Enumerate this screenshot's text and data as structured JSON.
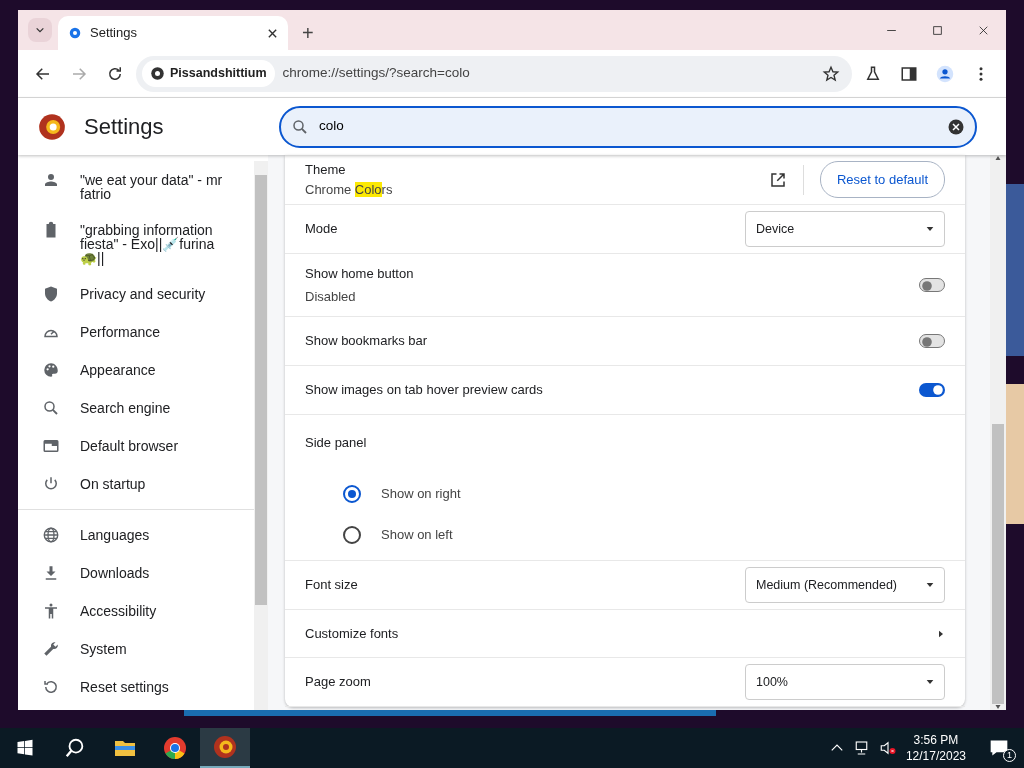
{
  "window": {
    "tab_title": "Settings",
    "new_tab": "+"
  },
  "toolbar": {
    "site_name": "Pissandshittium",
    "url": "chrome://settings/?search=colo"
  },
  "header": {
    "title": "Settings",
    "search_value": "colo"
  },
  "sidebar": {
    "groups": [
      [
        {
          "label": "\"we eat your data\" - mr fatrio"
        },
        {
          "label": "\"grabbing information fiesta\" - Exo||💉furina 🐢||"
        },
        {
          "label": "Privacy and security"
        },
        {
          "label": "Performance"
        },
        {
          "label": "Appearance"
        },
        {
          "label": "Search engine"
        },
        {
          "label": "Default browser"
        },
        {
          "label": "On startup"
        }
      ],
      [
        {
          "label": "Languages"
        },
        {
          "label": "Downloads"
        },
        {
          "label": "Accessibility"
        },
        {
          "label": "System"
        },
        {
          "label": "Reset settings"
        }
      ]
    ]
  },
  "settings": [
    {
      "kind": "theme",
      "label": "Theme",
      "value_parts": [
        {
          "text": "Chrome ",
          "highlight": false
        },
        {
          "text": "Colo",
          "highlight": true
        },
        {
          "text": "rs",
          "highlight": false
        }
      ],
      "button": "Reset to default"
    },
    {
      "kind": "select",
      "label": "Mode",
      "value": "Device"
    },
    {
      "kind": "toggle",
      "label": "Show home button",
      "sublabel": "Disabled",
      "on": false
    },
    {
      "kind": "toggle",
      "label": "Show bookmarks bar",
      "on": false
    },
    {
      "kind": "toggle",
      "label": "Show images on tab hover preview cards",
      "on": true
    },
    {
      "kind": "radio",
      "label": "Side panel",
      "options": [
        {
          "label": "Show on right",
          "selected": true
        },
        {
          "label": "Show on left",
          "selected": false
        }
      ]
    },
    {
      "kind": "select",
      "label": "Font size",
      "value": "Medium (Recommended)"
    },
    {
      "kind": "submenu",
      "label": "Customize fonts"
    },
    {
      "kind": "select",
      "label": "Page zoom",
      "value": "100%"
    }
  ],
  "taskbar": {
    "apps": [
      {
        "active": false
      },
      {
        "active": false
      },
      {
        "active": true
      }
    ],
    "time": "3:56 PM",
    "date": "12/17/2023",
    "notifications": "1"
  }
}
